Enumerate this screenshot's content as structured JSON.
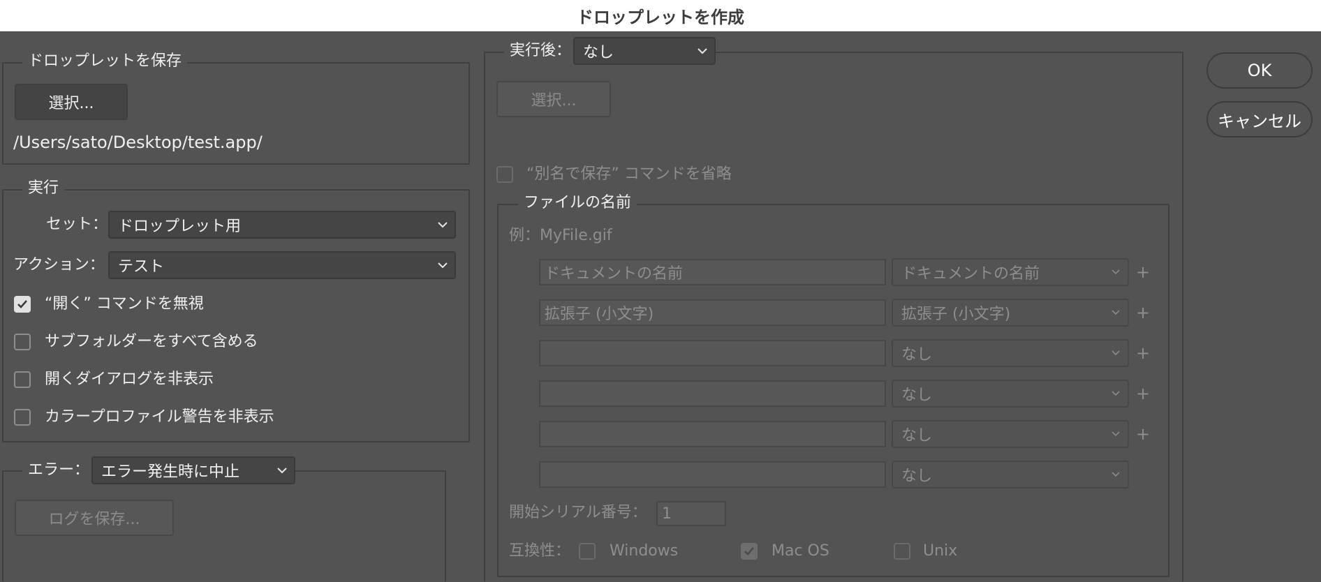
{
  "window": {
    "title": "ドロップレットを作成"
  },
  "save_droplet": {
    "legend": "ドロップレットを保存",
    "choose_label": "選択...",
    "path": "/Users/sato/Desktop/test.app/"
  },
  "play": {
    "legend": "実行",
    "set_label": "セット：",
    "set_value": "ドロップレット用",
    "action_label": "アクション：",
    "action_value": "テスト",
    "options": [
      {
        "label": "“開く” コマンドを無視",
        "checked": true
      },
      {
        "label": "サブフォルダーをすべて含める",
        "checked": false
      },
      {
        "label": "開くダイアログを非表示",
        "checked": false
      },
      {
        "label": "カラープロファイル警告を非表示",
        "checked": false
      }
    ]
  },
  "errors": {
    "label": "エラー：",
    "value": "エラー発生時に中止",
    "save_log_label": "ログを保存..."
  },
  "destination": {
    "label": "実行後：",
    "value": "なし",
    "choose_label": "選択...",
    "override_label": "“別名で保存” コマンドを省略",
    "override_checked": false
  },
  "file_naming": {
    "legend": "ファイルの名前",
    "example": "例：MyFile.gif",
    "rows": [
      {
        "text": "ドキュメントの名前",
        "select": "ドキュメントの名前",
        "plus": "+"
      },
      {
        "text": "拡張子 (小文字)",
        "select": "拡張子 (小文字)",
        "plus": "+"
      },
      {
        "text": "",
        "select": "なし",
        "plus": "+"
      },
      {
        "text": "",
        "select": "なし",
        "plus": "+"
      },
      {
        "text": "",
        "select": "なし",
        "plus": "+"
      },
      {
        "text": "",
        "select": "なし",
        "plus": ""
      }
    ],
    "serial_label": "開始シリアル番号：",
    "serial_value": "1",
    "compat_label": "互換性：",
    "compat": [
      {
        "label": "Windows",
        "checked": false
      },
      {
        "label": "Mac OS",
        "checked": true
      },
      {
        "label": "Unix",
        "checked": false
      }
    ]
  },
  "buttons": {
    "ok": "OK",
    "cancel": "キャンセル"
  }
}
